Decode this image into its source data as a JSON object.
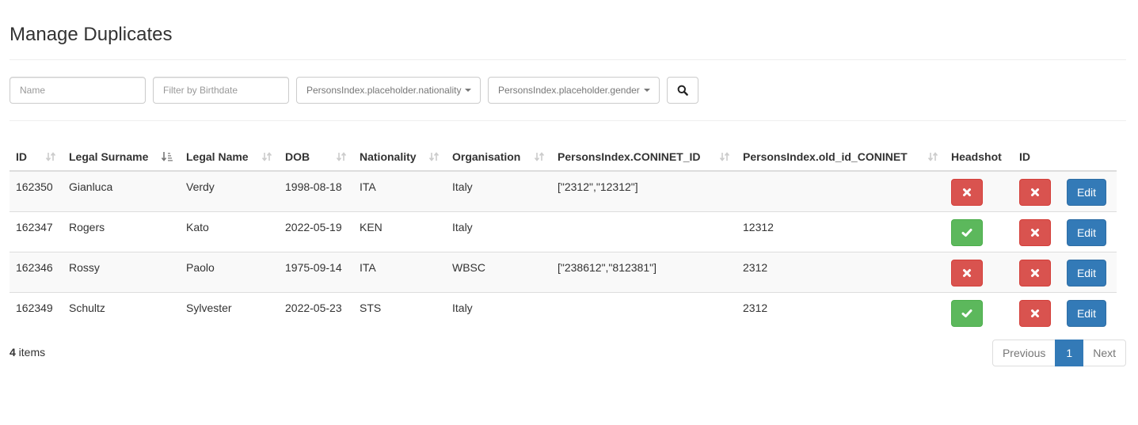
{
  "page": {
    "title": "Manage Duplicates"
  },
  "filters": {
    "name_placeholder": "Name",
    "name_value": "",
    "birthdate_placeholder": "Filter by Birthdate",
    "birthdate_value": "",
    "nationality_label": "PersonsIndex.placeholder.nationality",
    "gender_label": "PersonsIndex.placeholder.gender",
    "search_icon": "search-icon"
  },
  "table": {
    "columns": [
      {
        "label": "ID",
        "sortable": true,
        "sort": "none"
      },
      {
        "label": "Legal Surname",
        "sortable": true,
        "sort": "ascending"
      },
      {
        "label": "Legal Name",
        "sortable": true,
        "sort": "none"
      },
      {
        "label": "DOB",
        "sortable": true,
        "sort": "none"
      },
      {
        "label": "Nationality",
        "sortable": true,
        "sort": "none"
      },
      {
        "label": "Organisation",
        "sortable": true,
        "sort": "none"
      },
      {
        "label": "PersonsIndex.CONINET_ID",
        "sortable": true,
        "sort": "none"
      },
      {
        "label": "PersonsIndex.old_id_CONINET",
        "sortable": true,
        "sort": "none"
      },
      {
        "label": "Headshot",
        "sortable": false
      },
      {
        "label": "ID",
        "sortable": false
      },
      {
        "label": "",
        "sortable": false
      }
    ],
    "rows": [
      {
        "id": "162350",
        "surname": "Gianluca",
        "name": "Verdy",
        "dob": "1998-08-18",
        "nationality": "ITA",
        "organisation": "Italy",
        "coninet_id": "[\"2312\",\"12312\"]",
        "old_id": "",
        "headshot": "missing",
        "id_doc": "missing",
        "edit_label": "Edit"
      },
      {
        "id": "162347",
        "surname": "Rogers",
        "name": "Kato",
        "dob": "2022-05-19",
        "nationality": "KEN",
        "organisation": "Italy",
        "coninet_id": "",
        "old_id": "12312",
        "headshot": "present",
        "id_doc": "missing",
        "edit_label": "Edit"
      },
      {
        "id": "162346",
        "surname": "Rossy",
        "name": "Paolo",
        "dob": "1975-09-14",
        "nationality": "ITA",
        "organisation": "WBSC",
        "coninet_id": "[\"238612\",\"812381\"]",
        "old_id": "2312",
        "headshot": "missing",
        "id_doc": "missing",
        "edit_label": "Edit"
      },
      {
        "id": "162349",
        "surname": "Schultz",
        "name": "Sylvester",
        "dob": "2022-05-23",
        "nationality": "STS",
        "organisation": "Italy",
        "coninet_id": "",
        "old_id": "2312",
        "headshot": "present",
        "id_doc": "missing",
        "edit_label": "Edit"
      }
    ]
  },
  "footer": {
    "count": "4",
    "count_suffix": " items",
    "pagination": {
      "previous": "Previous",
      "current": "1",
      "next": "Next"
    }
  },
  "colors": {
    "danger": "#d9534f",
    "success": "#5cb85c",
    "primary": "#337ab7"
  }
}
